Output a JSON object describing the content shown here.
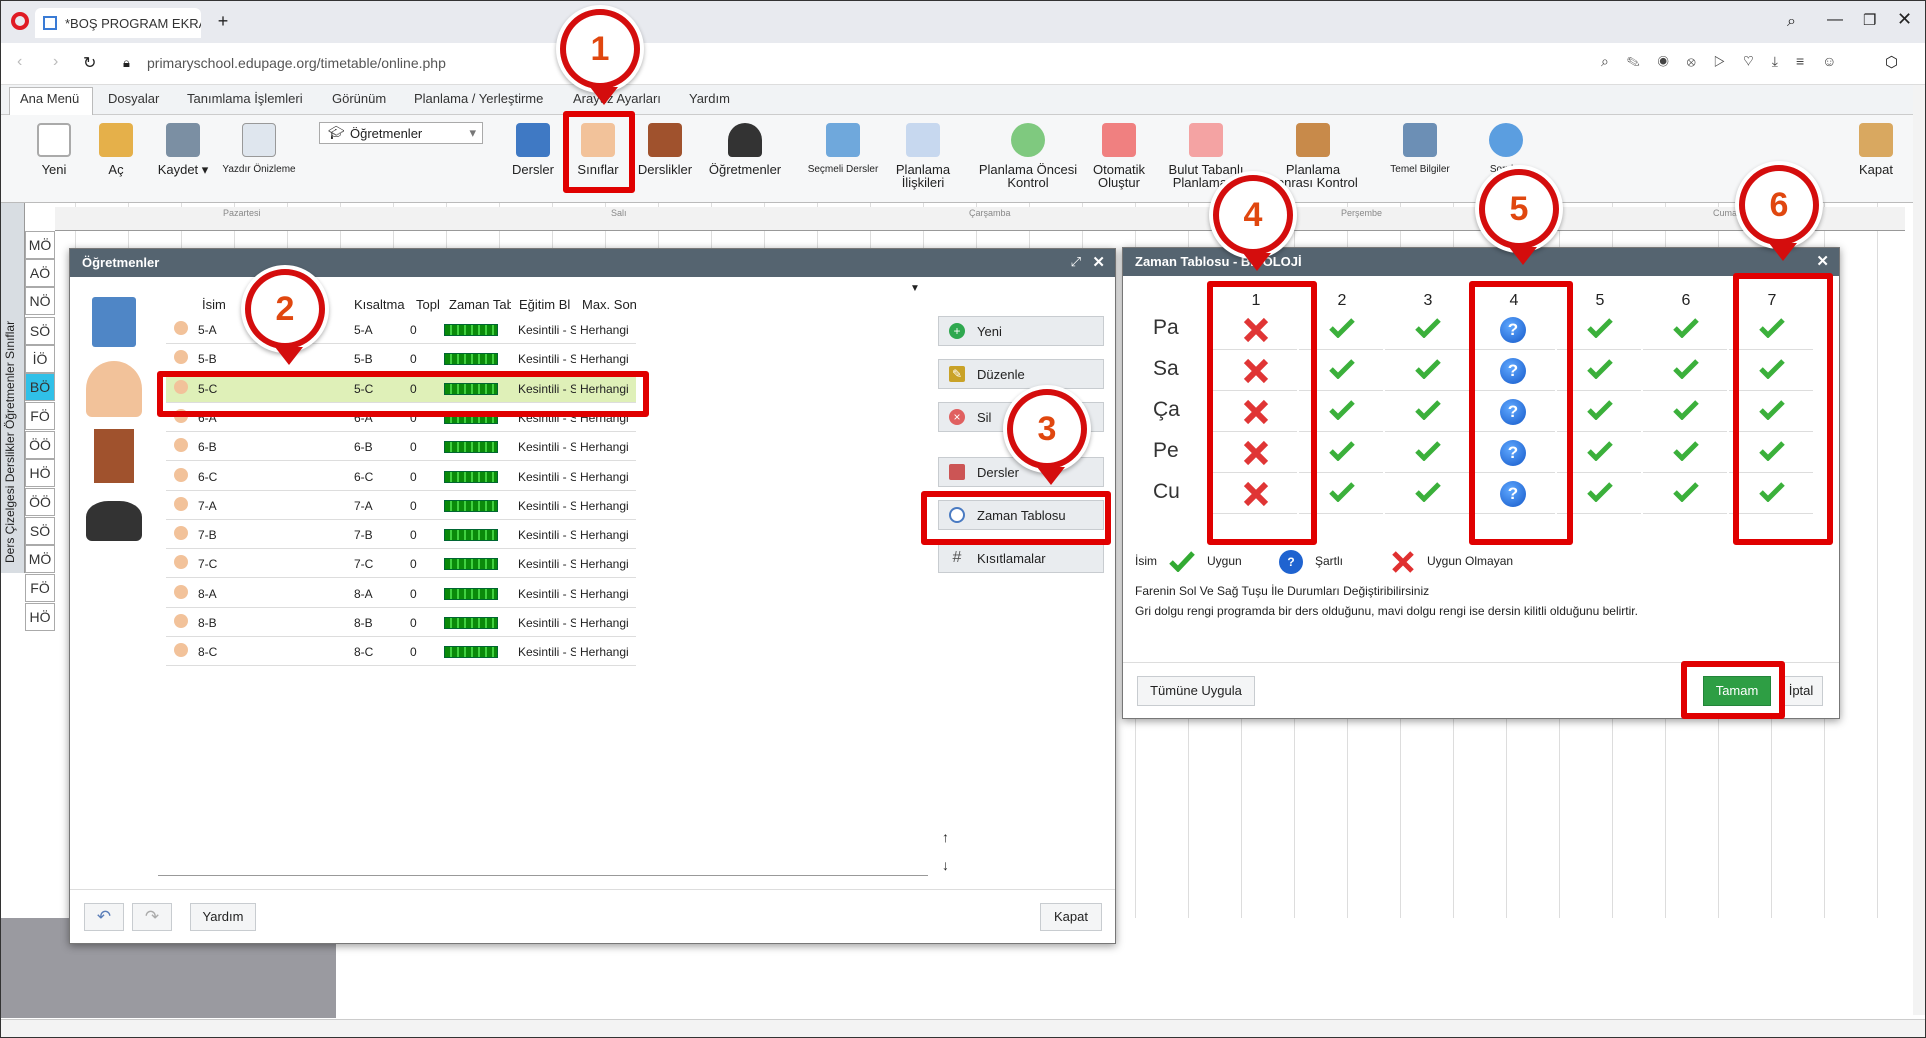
{
  "browser": {
    "tab_title": "*BOŞ PROGRAM EKRAN F",
    "url": "primaryschool.edupage.org/timetable/online.php"
  },
  "menu": [
    "Ana Menü",
    "Dosyalar",
    "Tanımlama İşlemleri",
    "Görünüm",
    "Planlama / Yerleştirme",
    "Arayüz Ayarları",
    "Yardım"
  ],
  "ribbon": {
    "yeni": "Yeni",
    "ac": "Aç",
    "kaydet": "Kaydet",
    "yazdir": "Yazdır Önizleme",
    "select": "Öğretmenler",
    "dersler": "Dersler",
    "siniflar": "Sınıflar",
    "derslikler": "Derslikler",
    "ogretmenler": "Öğretmenler",
    "secmeli": "Seçmeli Dersler",
    "iliski1": "Planlama",
    "iliski2": "İlişkileri",
    "oncesi1": "Planlama Öncesi",
    "oncesi2": "Kontrol",
    "oto1": "Otomatik",
    "oto2": "Oluştur",
    "bulut1": "Bulut Tabanlı",
    "bulut2": "Planlama B",
    "sonrasi1": "Planlama",
    "sonrasi2": "Sonrası Kontrol",
    "temel": "Temel Bilgiler",
    "soru": "Sorular",
    "kapat": "Kapat"
  },
  "days_header": [
    "Pazartesi",
    "Salı",
    "Çarşamba",
    "Perşembe",
    "Cuma"
  ],
  "side_tabs": "Ders Çizelgesi Derslikler Öğretmenler Sınıflar",
  "row_labels": [
    "MÖ",
    "AÖ",
    "NÖ",
    "SÖ",
    "İÖ",
    "BÖ",
    "FÖ",
    "ÖÖ",
    "HÖ",
    "ÖÖ",
    "SÖ",
    "MÖ",
    "FÖ",
    "HÖ"
  ],
  "dlg1": {
    "title": "Öğretmenler",
    "headers": [
      "İsim",
      "Kısaltma",
      "Topl",
      "Zaman Tab",
      "Eğitim Bl",
      "Max. Son"
    ],
    "rows": [
      {
        "name": "5-A",
        "abbr": "5-A",
        "total": "0",
        "edu": "Kesintili - S",
        "max": "Herhangi"
      },
      {
        "name": "5-B",
        "abbr": "5-B",
        "total": "0",
        "edu": "Kesintili - S",
        "max": "Herhangi"
      },
      {
        "name": "5-C",
        "abbr": "5-C",
        "total": "0",
        "edu": "Kesintili - S",
        "max": "Herhangi"
      },
      {
        "name": "6-A",
        "abbr": "6-A",
        "total": "0",
        "edu": "Kesintili - S",
        "max": "Herhangi"
      },
      {
        "name": "6-B",
        "abbr": "6-B",
        "total": "0",
        "edu": "Kesintili - S",
        "max": "Herhangi"
      },
      {
        "name": "6-C",
        "abbr": "6-C",
        "total": "0",
        "edu": "Kesintili - S",
        "max": "Herhangi"
      },
      {
        "name": "7-A",
        "abbr": "7-A",
        "total": "0",
        "edu": "Kesintili - S",
        "max": "Herhangi"
      },
      {
        "name": "7-B",
        "abbr": "7-B",
        "total": "0",
        "edu": "Kesintili - S",
        "max": "Herhangi"
      },
      {
        "name": "7-C",
        "abbr": "7-C",
        "total": "0",
        "edu": "Kesintili - S",
        "max": "Herhangi"
      },
      {
        "name": "8-A",
        "abbr": "8-A",
        "total": "0",
        "edu": "Kesintili - S",
        "max": "Herhangi"
      },
      {
        "name": "8-B",
        "abbr": "8-B",
        "total": "0",
        "edu": "Kesintili - S",
        "max": "Herhangi"
      },
      {
        "name": "8-C",
        "abbr": "8-C",
        "total": "0",
        "edu": "Kesintili - S",
        "max": "Herhangi"
      }
    ],
    "buttons": {
      "yeni": "Yeni",
      "duzenle": "Düzenle",
      "sil": "Sil",
      "dersler": "Dersler",
      "zaman": "Zaman Tablosu",
      "kisit": "Kısıtlamalar"
    },
    "footer": {
      "yardim": "Yardım",
      "kapat": "Kapat"
    }
  },
  "dlg2": {
    "title": "Zaman Tablosu - BİYOLOJİ",
    "columns": [
      "1",
      "2",
      "3",
      "4",
      "5",
      "6",
      "7"
    ],
    "days": [
      "Pa",
      "Sa",
      "Ça",
      "Pe",
      "Cu"
    ],
    "legend": {
      "isim": "İsim",
      "uygun": "Uygun",
      "sartli": "Şartlı",
      "uygun_olmayan": "Uygun Olmayan"
    },
    "info1": "Farenin Sol Ve Sağ Tuşu İle Durumları Değiştiribilirsiniz",
    "info2": "Gri dolgu rengi programda bir ders olduğunu, mavi dolgu rengi ise dersin kilitli olduğunu belirtir.",
    "tumune": "Tümüne Uygula",
    "tamam": "Tamam",
    "iptal": "İptal"
  },
  "callouts": [
    "1",
    "2",
    "3",
    "4",
    "5",
    "6"
  ],
  "colors": {
    "accent_red": "#e00000",
    "header": "#556470",
    "ok_green": "#33aa33"
  }
}
